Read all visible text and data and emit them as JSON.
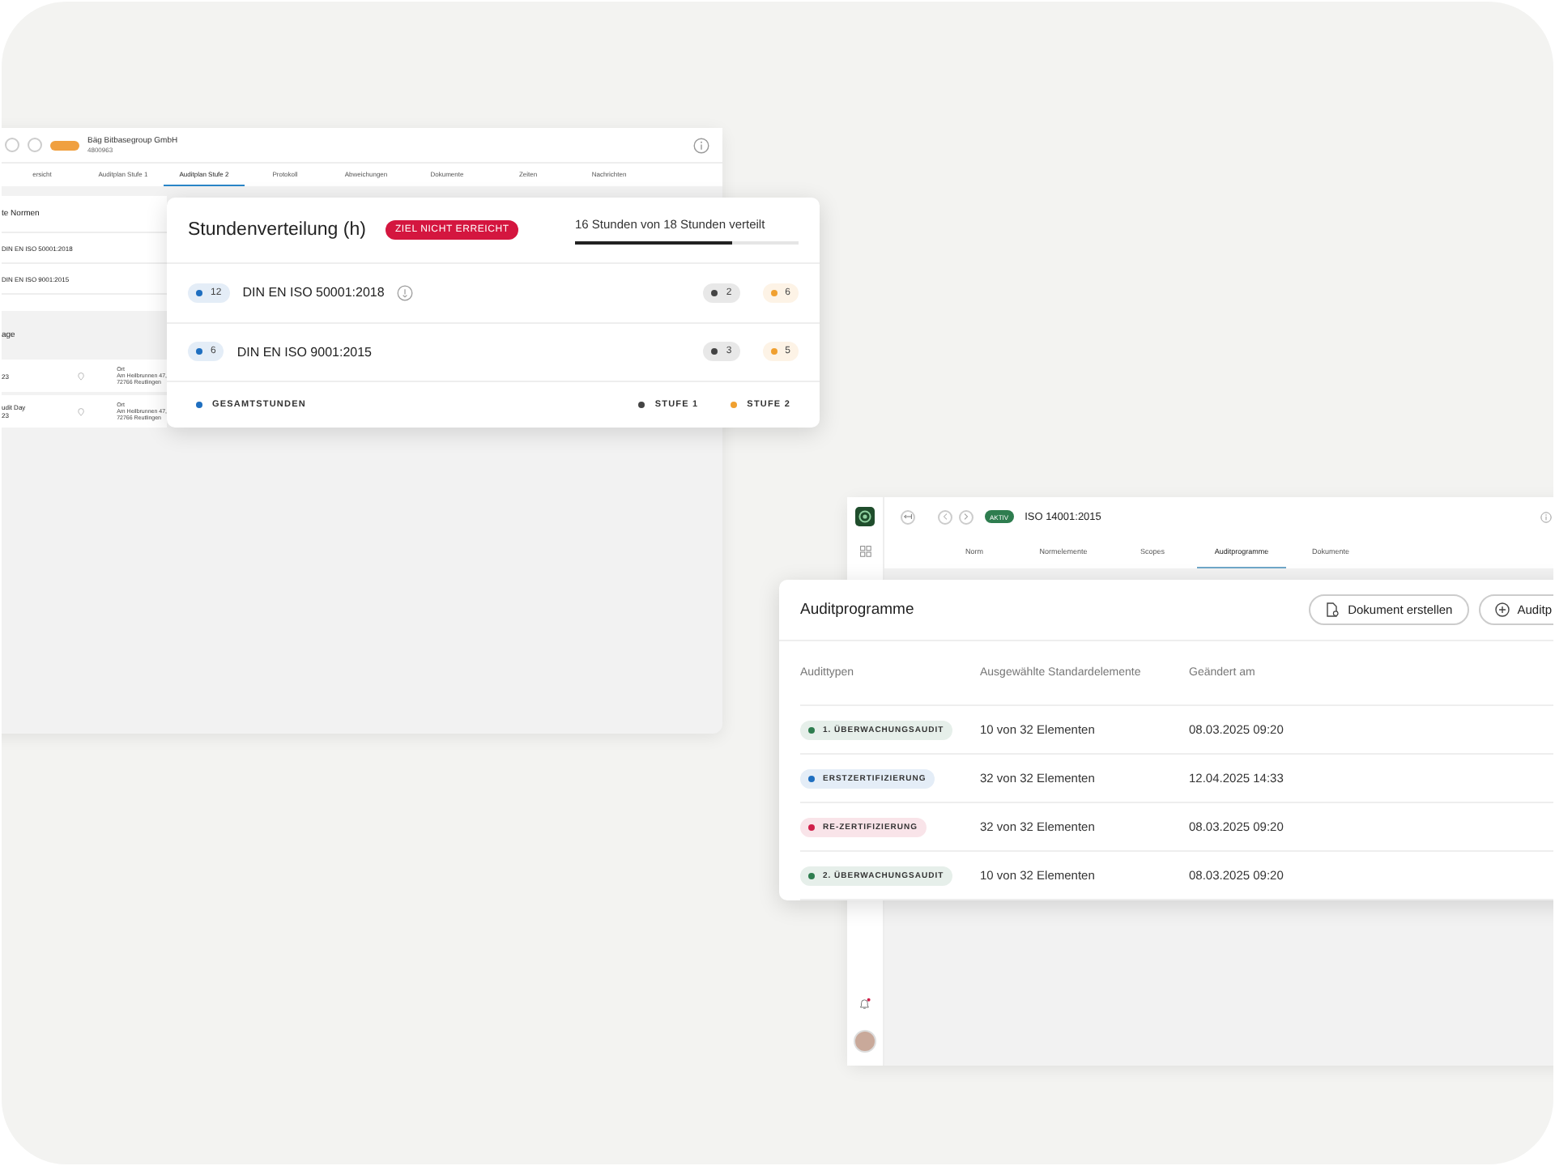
{
  "background_window": {
    "company": "Bäg Bitbasegroup GmbH",
    "number": "4800963",
    "tabs": [
      {
        "label": "ersicht",
        "selected": false
      },
      {
        "label": "Auditplan Stufe 1",
        "selected": false
      },
      {
        "label": "Auditplan Stufe 2",
        "selected": true
      },
      {
        "label": "Protokoll",
        "selected": false
      },
      {
        "label": "Abweichungen",
        "selected": false
      },
      {
        "label": "Dokumente",
        "selected": false
      },
      {
        "label": "Zeiten",
        "selected": false
      },
      {
        "label": "Nachrichten",
        "selected": false
      }
    ],
    "panel_title": "te Normen",
    "norms": [
      "DIN EN ISO 50001:2018",
      "DIN EN ISO 9001:2015"
    ],
    "section_title": "age",
    "days": [
      {
        "date": "23",
        "place_label": "Ort",
        "address": "Am Heilbrunnen 47,",
        "city": "72766 Reutlingen"
      },
      {
        "title": "udit Day",
        "date": "23",
        "place_label": "Ort",
        "address": "Am Heilbrunnen 47,",
        "city": "72766 Reutlingen"
      }
    ]
  },
  "hours_card": {
    "title": "Stundenverteilung (h)",
    "status": "ZIEL NICHT ERREICHT",
    "summary": "16 Stunden von 18 Stunden verteilt",
    "level": 0.7,
    "rows": [
      {
        "norm": "DIN EN ISO 50001:2018",
        "total": "12",
        "stage1": "2",
        "stage2": "6",
        "info": true
      },
      {
        "norm": "DIN EN ISO 9001:2015",
        "total": "6",
        "stage1": "3",
        "stage2": "5",
        "info": false
      }
    ],
    "legend": [
      {
        "label": "GESAMTSTUNDEN",
        "color": "#1f6fc0"
      },
      {
        "label": "STUFE 1",
        "color": "#444444"
      },
      {
        "label": "STUFE 2",
        "color": "#f0a030"
      }
    ]
  },
  "norm_window": {
    "status": "AKTIV",
    "title": "ISO 14001:2015",
    "tabs": [
      {
        "label": "Norm",
        "selected": false
      },
      {
        "label": "Normelemente",
        "selected": false
      },
      {
        "label": "Scopes",
        "selected": false
      },
      {
        "label": "Auditprogramme",
        "selected": true
      },
      {
        "label": "Dokumente",
        "selected": false
      }
    ]
  },
  "program_card": {
    "title": "Auditprogramme",
    "buttons": [
      {
        "label": "Dokument erstellen",
        "kind": "document"
      },
      {
        "label": "Auditp",
        "kind": "add"
      }
    ],
    "columns": [
      "Audittypen",
      "Ausgewählte Standardelemente",
      "Geändert am"
    ],
    "rows": [
      {
        "type": "1. ÜBERWACHUNGSAUDIT",
        "color": "#2e7d4f",
        "elements": "10 von 32 Elementen",
        "changed": "08.03.2025 09:20"
      },
      {
        "type": "ERSTZERTIFIZIERUNG",
        "color": "#1f6fc0",
        "elements": "32 von 32 Elementen",
        "changed": "12.04.2025 14:33"
      },
      {
        "type": "RE-ZERTIFIZIERUNG",
        "color": "#d0204a",
        "elements": "32 von 32 Elementen",
        "changed": "08.03.2025 09:20"
      },
      {
        "type": "2. ÜBERWACHUNGSAUDIT",
        "color": "#2e7d4f",
        "elements": "10 von 32 Elementen",
        "changed": "08.03.2025 09:20"
      }
    ]
  }
}
